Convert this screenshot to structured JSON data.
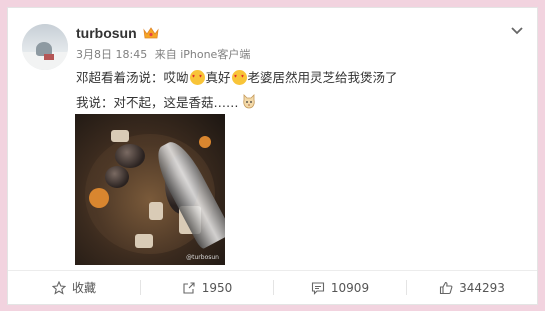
{
  "post": {
    "username": "turbosun",
    "date": "3月8日 18:45",
    "source": "来自 iPhone客户端",
    "line1_a": "邓超看着汤说：哎呦",
    "line1_b": "真好",
    "line1_c": "老婆居然用灵芝给我煲汤了",
    "line2": "我说：对不起，这是香菇……",
    "photo_watermark": "@turbosun"
  },
  "actions": {
    "favorite_label": "收藏",
    "repost_count": "1950",
    "comment_count": "10909",
    "like_count": "344293"
  },
  "icons": [
    "crown-icon",
    "chevron-down-icon",
    "heart-eyes-emoji",
    "cat-emoji",
    "star-icon",
    "repost-icon",
    "comment-icon",
    "like-icon"
  ],
  "colors": {
    "background": "#f2d3df",
    "card": "#ffffff",
    "text": "#333333",
    "meta": "#808080"
  }
}
